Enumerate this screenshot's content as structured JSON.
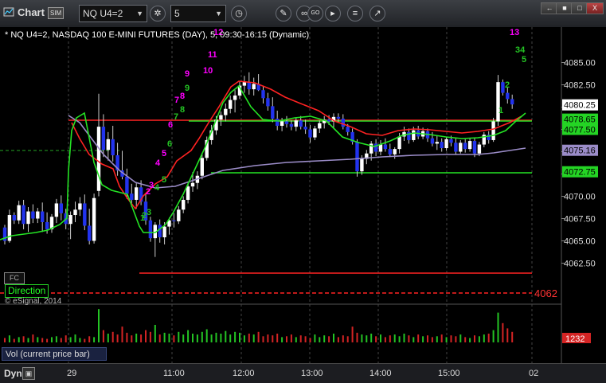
{
  "window": {
    "title": "Chart",
    "badge": "SIM",
    "symbol": "NQ U4=2",
    "interval": "5",
    "buttons": [
      "←",
      "■",
      "□",
      "X"
    ]
  },
  "toolbar_icons": [
    "gear-icon",
    "clock-icon",
    "pencil-icon",
    "link-icon",
    "go-icon",
    "play-icon",
    "bars-icon",
    "pointer-icon"
  ],
  "chart": {
    "info_line": "* NQ U4=2, NASDAQ 100 E-MINI FUTURES (DAY), 5, 09:30-16:15 (Dynamic)",
    "direction_label": "Direction",
    "fc_label": "FC",
    "copyright": "© eSignal, 2014",
    "price_axis": [
      "4085.00",
      "4082.50",
      "4080.00",
      "4077.50",
      "4075.00",
      "4072.50",
      "4070.00",
      "4067.50",
      "4065.00",
      "4062.50"
    ],
    "price_tags": [
      {
        "label": "4080.25",
        "color": "#ffffff"
      },
      {
        "label": "4078.65",
        "color": "#24d424"
      },
      {
        "label": "4077.50",
        "color": "#24d424"
      },
      {
        "label": "4075.16",
        "color": "#9b8cc8"
      },
      {
        "label": "4072.75",
        "color": "#24d424"
      }
    ],
    "dashed_level_label": "4062",
    "volume_tag": "1232",
    "volume_label": "Vol (current price bar)",
    "time_axis": [
      "29",
      "11:00",
      "12:00",
      "13:00",
      "14:00",
      "15:00",
      "02"
    ],
    "td_counts": [
      {
        "text": "1",
        "color": "#24c424"
      },
      {
        "text": "2",
        "color": "#ff00ff"
      },
      {
        "text": "3",
        "color": "#ff00ff"
      },
      {
        "text": "4",
        "color": "#ff00ff"
      },
      {
        "text": "5",
        "color": "#ff00ff"
      },
      {
        "text": "6",
        "color": "#ff00ff"
      },
      {
        "text": "7",
        "color": "#ff00ff"
      },
      {
        "text": "8",
        "color": "#ff00ff"
      },
      {
        "text": "9",
        "color": "#ff00ff"
      },
      {
        "text": "10",
        "color": "#ff00ff"
      },
      {
        "text": "11",
        "color": "#ff00ff"
      },
      {
        "text": "12",
        "color": "#ff00ff"
      },
      {
        "text": "13",
        "color": "#ff00ff"
      },
      {
        "text": "34",
        "color": "#24c424"
      },
      {
        "text": "5",
        "color": "#24c424"
      },
      {
        "text": "2",
        "color": "#24c424"
      },
      {
        "text": "1",
        "color": "#24c424"
      },
      {
        "text": "2",
        "color": "#24c424"
      },
      {
        "text": "3",
        "color": "#24c424"
      },
      {
        "text": "4",
        "color": "#24c424"
      },
      {
        "text": "5",
        "color": "#24c424"
      },
      {
        "text": "6",
        "color": "#24c424"
      },
      {
        "text": "7",
        "color": "#24c424"
      },
      {
        "text": "8",
        "color": "#24c424"
      },
      {
        "text": "9",
        "color": "#24c424"
      }
    ]
  },
  "bottom": {
    "dyn_label": "Dyn"
  },
  "colors": {
    "up_candle": "#ffffff",
    "down_candle": "#2233ee",
    "red_line": "#ff2222",
    "green_line": "#24e424",
    "purple_line": "#9b8cc8",
    "volume_green": "#24c424",
    "volume_red": "#d42424"
  }
}
